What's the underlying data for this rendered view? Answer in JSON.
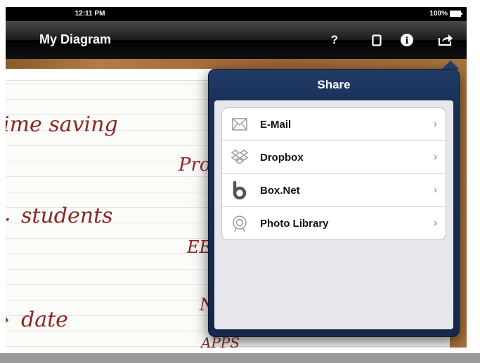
{
  "status_bar": {
    "time": "12:11 PM",
    "battery": "100%"
  },
  "nav_bar": {
    "title": "My Diagram",
    "help_label": "?",
    "info_label": "i"
  },
  "notes": [
    "ime saving",
    "Pro",
    "students",
    "EE",
    "date",
    "N",
    "APPS"
  ],
  "share_popover": {
    "title": "Share",
    "items": [
      {
        "label": "E-Mail",
        "icon": "envelope-icon"
      },
      {
        "label": "Dropbox",
        "icon": "dropbox-icon"
      },
      {
        "label": "Box.Net",
        "icon": "box-net-icon"
      },
      {
        "label": "Photo Library",
        "icon": "photo-library-icon"
      }
    ]
  },
  "colors": {
    "popover": "#1c3560",
    "handwriting": "#8e2424"
  }
}
